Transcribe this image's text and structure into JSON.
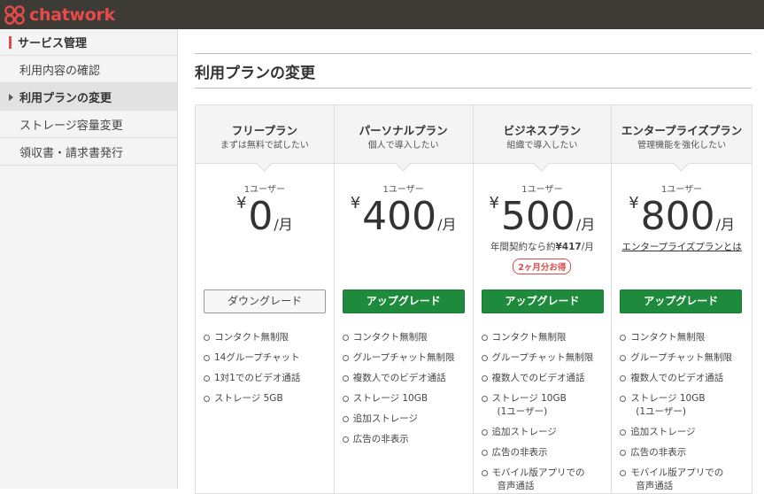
{
  "app": {
    "logo_text": "chatwork"
  },
  "sidebar": {
    "header": "サービス管理",
    "items": [
      {
        "label": "利用内容の確認",
        "active": false
      },
      {
        "label": "利用プランの変更",
        "active": true
      },
      {
        "label": "ストレージ容量変更",
        "active": false
      },
      {
        "label": "領収書・請求書発行",
        "active": false
      }
    ]
  },
  "main": {
    "title": "利用プランの変更",
    "plans": [
      {
        "name": "フリープラン",
        "subtitle": "まずは無料で試したい",
        "users": "1ユーザー",
        "currency": "¥",
        "price": "0",
        "per": "/月",
        "button": "ダウングレード",
        "features": [
          "コンタクト無制限",
          "14グループチャット",
          "1対1でのビデオ通話",
          "ストレージ 5GB"
        ]
      },
      {
        "name": "パーソナルプラン",
        "subtitle": "個人で導入したい",
        "users": "1ユーザー",
        "currency": "¥",
        "price": "400",
        "per": "/月",
        "button": "アップグレード",
        "features": [
          "コンタクト無制限",
          "グループチャット無制限",
          "複数人でのビデオ通話",
          "ストレージ 10GB",
          "追加ストレージ",
          "広告の非表示"
        ]
      },
      {
        "name": "ビジネスプラン",
        "subtitle": "組織で導入したい",
        "users": "1ユーザー",
        "currency": "¥",
        "price": "500",
        "per": "/月",
        "annual_note_prefix": "年間契約なら約",
        "annual_note_price": "¥417",
        "annual_note_suffix": "/月",
        "badge": "2ヶ月分お得",
        "button": "アップグレード",
        "features": [
          "コンタクト無制限",
          "グループチャット無制限",
          "複数人でのビデオ通話",
          "ストレージ 10GB",
          "(1ユーザー)",
          "追加ストレージ",
          "広告の非表示",
          "モバイル版アプリでの",
          "音声通話"
        ]
      },
      {
        "name": "エンタープライズプラン",
        "subtitle": "管理機能を強化したい",
        "users": "1ユーザー",
        "currency": "¥",
        "price": "800",
        "per": "/月",
        "link": "エンタープライズプランとは",
        "button": "アップグレード",
        "features": [
          "コンタクト無制限",
          "グループチャット無制限",
          "複数人でのビデオ通話",
          "ストレージ 10GB",
          "(1ユーザー)",
          "追加ストレージ",
          "広告の非表示",
          "モバイル版アプリでの",
          "音声通話"
        ]
      }
    ]
  },
  "colors": {
    "topbar": "#3c3b36",
    "brand_red": "#e84a4a",
    "upgrade_green": "#1e8a3c",
    "sidebar_bg": "#f4f4f4"
  }
}
